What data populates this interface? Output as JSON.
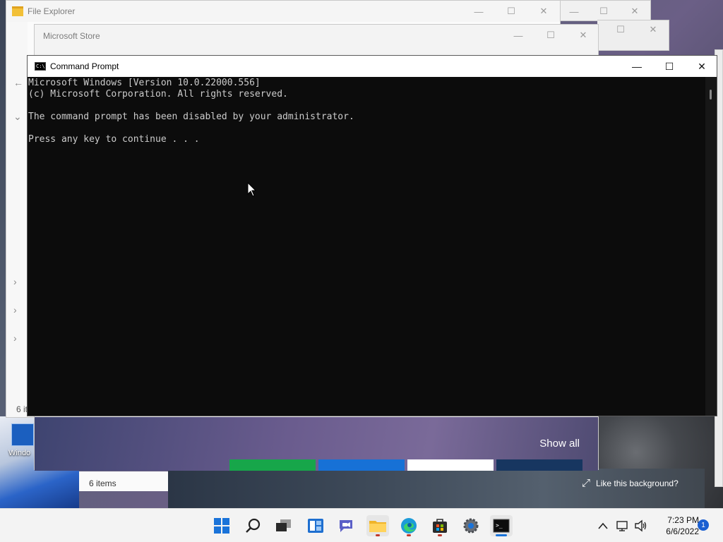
{
  "windows": {
    "explorer": {
      "title": "File Explorer",
      "status": "6 it",
      "controls": {
        "minimize": "—",
        "maximize": "☐",
        "close": "✕"
      }
    },
    "store": {
      "title": "Microsoft Store",
      "show_all": "Show all",
      "controls": {
        "minimize": "—",
        "maximize": "☐",
        "close": "✕"
      }
    },
    "explorer_second": {
      "status": "6 items"
    },
    "cmd": {
      "title": "Command Prompt",
      "icon_label": "C:\\",
      "lines": [
        "Microsoft Windows [Version 10.0.22000.556]",
        "(c) Microsoft Corporation. All rights reserved.",
        "",
        "The command prompt has been disabled by your administrator.",
        "",
        "Press any key to continue . . ."
      ],
      "controls": {
        "minimize": "—",
        "maximize": "☐",
        "close": "✕"
      }
    }
  },
  "desktop": {
    "icon_label": "Windo",
    "like_background": "Like this background?"
  },
  "taskbar": {
    "apps": [
      {
        "name": "start",
        "icon": "windows-logo-icon"
      },
      {
        "name": "search",
        "icon": "search-icon"
      },
      {
        "name": "task-view",
        "icon": "task-view-icon"
      },
      {
        "name": "widgets",
        "icon": "widgets-icon"
      },
      {
        "name": "chat",
        "icon": "chat-icon"
      },
      {
        "name": "file-explorer",
        "icon": "folder-icon"
      },
      {
        "name": "edge",
        "icon": "edge-icon"
      },
      {
        "name": "store",
        "icon": "store-icon"
      },
      {
        "name": "settings",
        "icon": "gear-icon"
      },
      {
        "name": "terminal",
        "icon": "terminal-icon"
      }
    ],
    "clock": {
      "time": "7:23 PM",
      "date": "6/6/2022"
    },
    "notification_count": "1"
  },
  "colors": {
    "cmd_background": "#0c0c0c",
    "cmd_text": "#cccccc",
    "taskbar_bg": "#f3f3f3",
    "accent": "#1a73d9"
  }
}
